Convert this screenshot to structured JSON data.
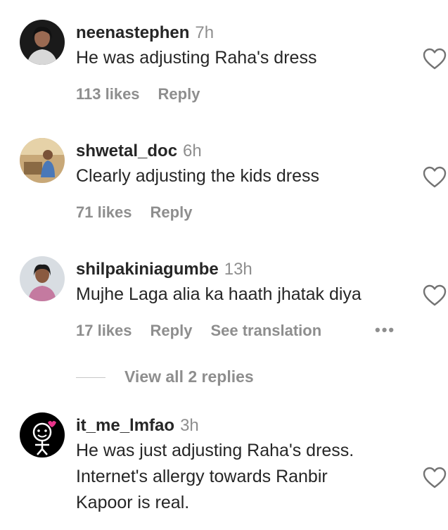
{
  "comments": [
    {
      "username": "neenastephen",
      "time": "7h",
      "text": "He was adjusting Raha's dress",
      "likes": "113 likes",
      "reply": "Reply"
    },
    {
      "username": "shwetal_doc",
      "time": "6h",
      "text": "Clearly adjusting the kids dress",
      "likes": "71 likes",
      "reply": "Reply"
    },
    {
      "username": "shilpakiniagumbe",
      "time": "13h",
      "text": "Mujhe Laga alia ka haath jhatak diya",
      "likes": "17 likes",
      "reply": "Reply",
      "translate": "See translation",
      "more": "•••"
    },
    {
      "username": "it_me_lmfao",
      "time": "3h",
      "text": "He was just adjusting Raha's dress.\nInternet's allergy towards Ranbir\nKapoor is real."
    }
  ],
  "view_replies": "View all 2 replies",
  "icons": {
    "like": "heart-outline-icon",
    "more": "more-horizontal-icon"
  },
  "colors": {
    "primary_text": "#262626",
    "secondary_text": "#8e8e8e",
    "background": "#ffffff"
  }
}
